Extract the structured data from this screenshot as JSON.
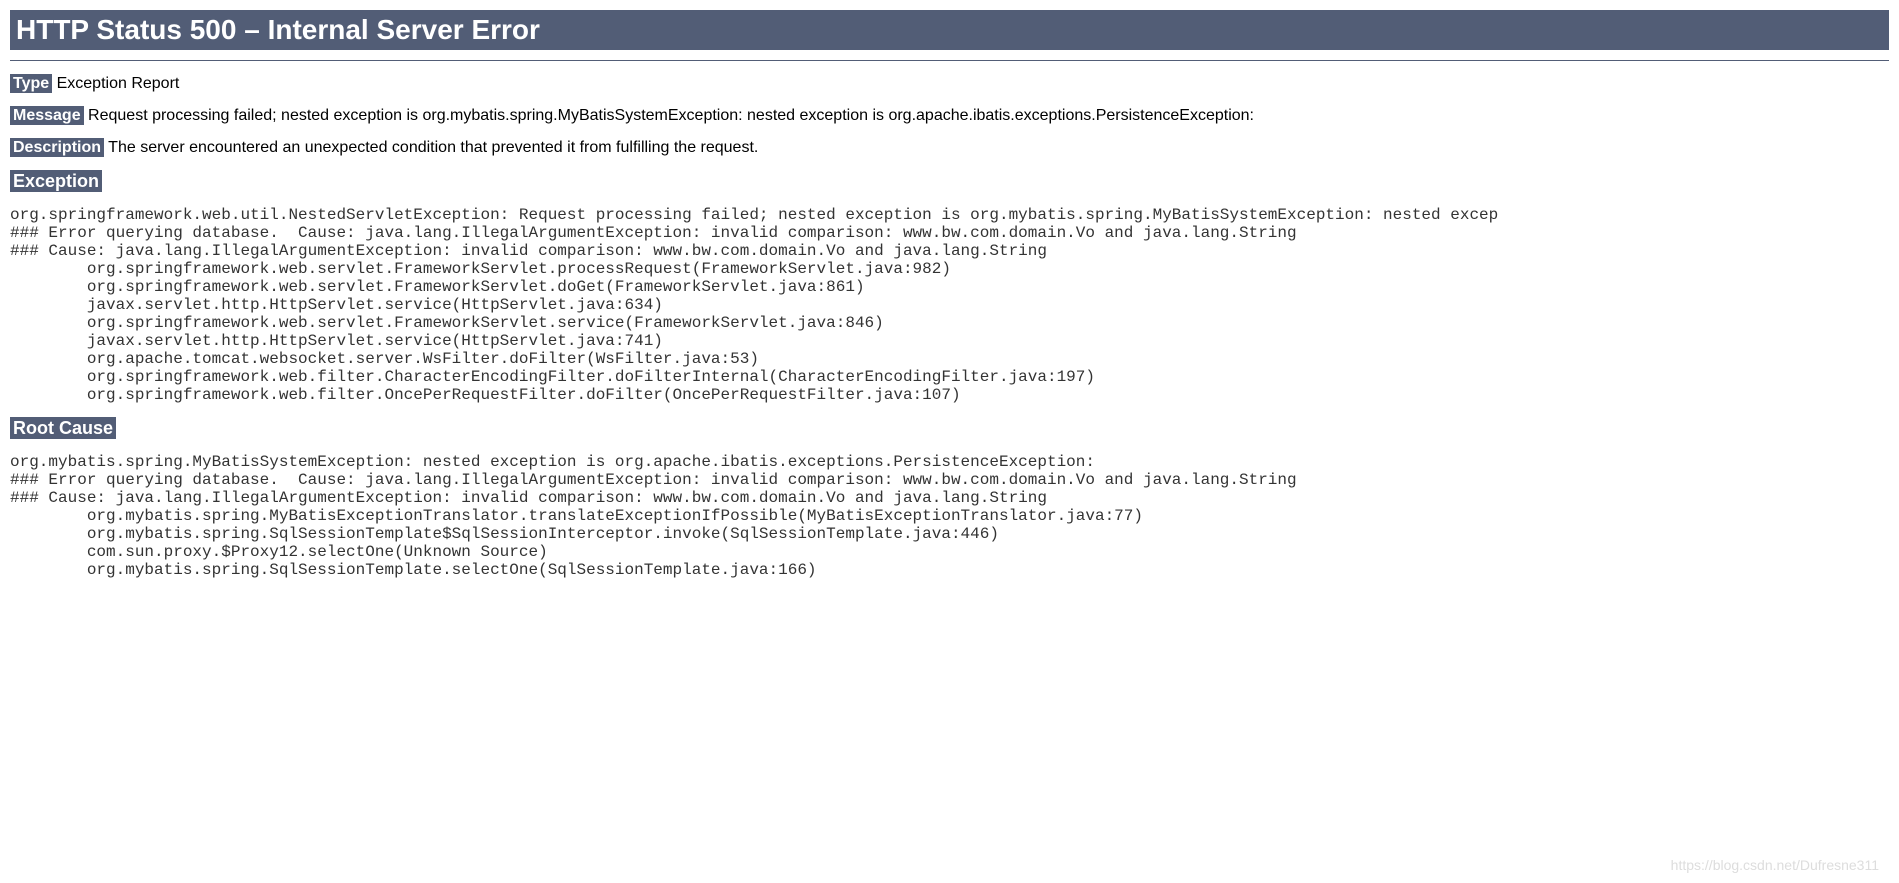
{
  "header": {
    "title": "HTTP Status 500 – Internal Server Error"
  },
  "type_row": {
    "label": "Type",
    "value": " Exception Report"
  },
  "message_row": {
    "label": "Message",
    "value": " Request processing failed; nested exception is org.mybatis.spring.MyBatisSystemException: nested exception is org.apache.ibatis.exceptions.PersistenceException:"
  },
  "description_row": {
    "label": "Description",
    "value": " The server encountered an unexpected condition that prevented it from fulfilling the request."
  },
  "exception_section": {
    "heading": "Exception",
    "trace": "org.springframework.web.util.NestedServletException: Request processing failed; nested exception is org.mybatis.spring.MyBatisSystemException: nested excep\n### Error querying database.  Cause: java.lang.IllegalArgumentException: invalid comparison: www.bw.com.domain.Vo and java.lang.String\n### Cause: java.lang.IllegalArgumentException: invalid comparison: www.bw.com.domain.Vo and java.lang.String\n\torg.springframework.web.servlet.FrameworkServlet.processRequest(FrameworkServlet.java:982)\n\torg.springframework.web.servlet.FrameworkServlet.doGet(FrameworkServlet.java:861)\n\tjavax.servlet.http.HttpServlet.service(HttpServlet.java:634)\n\torg.springframework.web.servlet.FrameworkServlet.service(FrameworkServlet.java:846)\n\tjavax.servlet.http.HttpServlet.service(HttpServlet.java:741)\n\torg.apache.tomcat.websocket.server.WsFilter.doFilter(WsFilter.java:53)\n\torg.springframework.web.filter.CharacterEncodingFilter.doFilterInternal(CharacterEncodingFilter.java:197)\n\torg.springframework.web.filter.OncePerRequestFilter.doFilter(OncePerRequestFilter.java:107)"
  },
  "root_cause_section": {
    "heading": "Root Cause",
    "trace": "org.mybatis.spring.MyBatisSystemException: nested exception is org.apache.ibatis.exceptions.PersistenceException:\n### Error querying database.  Cause: java.lang.IllegalArgumentException: invalid comparison: www.bw.com.domain.Vo and java.lang.String\n### Cause: java.lang.IllegalArgumentException: invalid comparison: www.bw.com.domain.Vo and java.lang.String\n\torg.mybatis.spring.MyBatisExceptionTranslator.translateExceptionIfPossible(MyBatisExceptionTranslator.java:77)\n\torg.mybatis.spring.SqlSessionTemplate$SqlSessionInterceptor.invoke(SqlSessionTemplate.java:446)\n\tcom.sun.proxy.$Proxy12.selectOne(Unknown Source)\n\torg.mybatis.spring.SqlSessionTemplate.selectOne(SqlSessionTemplate.java:166)"
  },
  "watermark": "https://blog.csdn.net/Dufresne311"
}
